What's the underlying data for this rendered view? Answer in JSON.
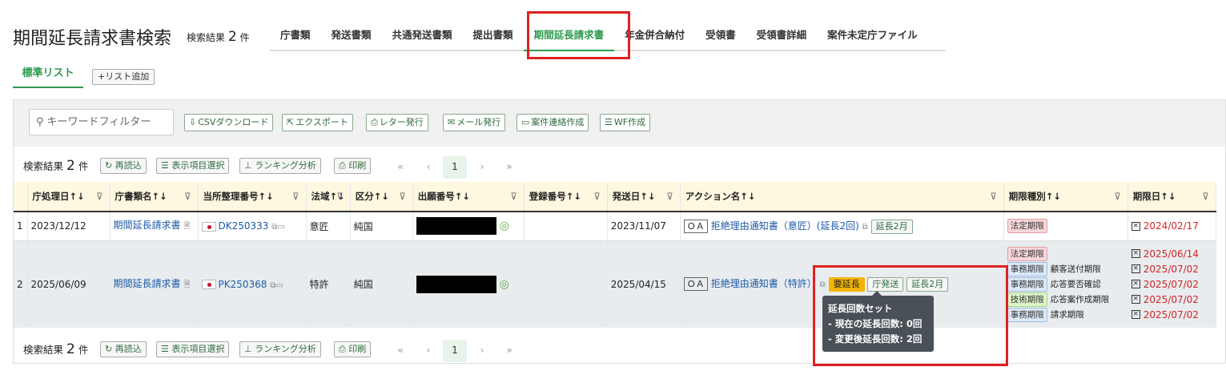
{
  "header": {
    "title": "期間延長請求書検索",
    "result_label": "検索結果",
    "result_count": "2",
    "result_unit": "件"
  },
  "tabs": [
    "庁書類",
    "発送書類",
    "共通発送書類",
    "提出書類",
    "期間延長請求書",
    "年金併合納付",
    "受領書",
    "受領書詳細",
    "案件未定庁ファイル"
  ],
  "active_tab": "期間延長請求書",
  "list_tab": "標準リスト",
  "add_list": "+リスト追加",
  "filter_placeholder": "キーワードフィルター",
  "toolbar_buttons": [
    "CSVダウンロード",
    "エクスポート",
    "レター発行",
    "メール発行",
    "案件連絡作成",
    "WF作成"
  ],
  "result_bar": {
    "label": "検索結果",
    "count": "2",
    "unit": "件",
    "reload": "再読込",
    "columns": "表示項目選択",
    "ranking": "ランキング分析",
    "print": "印刷",
    "page": "1"
  },
  "columns": [
    "庁処理日",
    "庁書類名",
    "当所整理番号",
    "法域",
    "区分",
    "出願番号",
    "登録番号",
    "発送日",
    "アクション名",
    "期限種別",
    "期限日"
  ],
  "rows": [
    {
      "no": "1",
      "date": "2023/12/12",
      "doc": "期間延長請求書",
      "ref": "DK250333",
      "domain": "意匠",
      "kubun": "純国",
      "send_date": "2023/11/07",
      "oa": "ＯＡ",
      "action": "拒絶理由通知書（意匠）(延長2回)",
      "badges": [
        "延長2月"
      ],
      "periods": [
        {
          "type": "法定期限",
          "desc": "",
          "date": "2024/02/17"
        }
      ]
    },
    {
      "no": "2",
      "date": "2025/06/09",
      "doc": "期間延長請求書",
      "ref": "PK250368",
      "domain": "特許",
      "kubun": "純国",
      "send_date": "2025/04/15",
      "oa": "ＯＡ",
      "action": "拒絶理由通知書（特許）",
      "badge_yellow": "要延長",
      "badges": [
        "庁発送",
        "延長2月"
      ],
      "periods": [
        {
          "type": "法定期限",
          "desc": "",
          "date": "2025/06/14"
        },
        {
          "type": "事務期限",
          "desc": "顧客送付期限",
          "date": "2025/07/02"
        },
        {
          "type": "事務期限",
          "desc": "応答要否確認",
          "date": "2025/07/02"
        },
        {
          "type": "技術期限",
          "desc": "応答案作成期限",
          "date": "2025/07/02"
        },
        {
          "type": "事務期限",
          "desc": "請求期限",
          "date": "2025/07/02"
        }
      ]
    }
  ],
  "tooltip": {
    "title": "延長回数セット",
    "line1": "- 現在の延長回数: 0回",
    "line2": "- 変更後延長回数: 2回"
  },
  "colors": {
    "accent": "#2e9a4e",
    "highlight": "#e02020",
    "deadline": "#d02626",
    "header_bg": "#fff8e1"
  }
}
